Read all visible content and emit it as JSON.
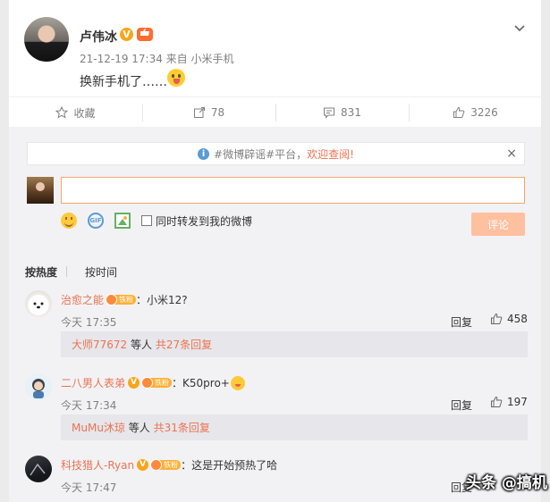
{
  "post": {
    "author": "卢伟冰",
    "verified_badge": "V",
    "meta": "21-12-19 17:34 来自 小米手机",
    "text": "换新手机了……",
    "emoji": "tongue-emoji"
  },
  "actions": {
    "favorite": "收藏",
    "repost_count": "78",
    "comment_count": "831",
    "like_count": "3226"
  },
  "tip": {
    "prefix": "#微博辟谣#平台，",
    "link": "欢迎查阅!",
    "close": "×"
  },
  "composer": {
    "input_value": "",
    "also_repost_label": "同时转发到我的微博",
    "submit_label": "评论",
    "gif_label": "GIF"
  },
  "sort": {
    "hot": "按热度",
    "time": "按时间"
  },
  "fan_badge_label": "铁粉",
  "reply_label": "回复",
  "comments": [
    {
      "user": "治愈之能",
      "verified": false,
      "sep": "：",
      "text": "小米12?",
      "time": "今天 17:35",
      "likes": "458",
      "sub_user": "大师77672",
      "sub_mid": " 等人 ",
      "sub_count": "共27条回复"
    },
    {
      "user": "二八男人表弟",
      "verified": true,
      "sep": "：",
      "text": "K50pro+",
      "time": "今天 17:34",
      "likes": "197",
      "sub_user": "MuMu沐琼",
      "sub_mid": " 等人 ",
      "sub_count": "共31条回复"
    },
    {
      "user": "科技猎人-Ryan",
      "verified": true,
      "sep": "：",
      "text": "这是开始预热了哈",
      "time": "今天 17:47",
      "likes": ""
    }
  ],
  "watermark": "头条 @搞机"
}
